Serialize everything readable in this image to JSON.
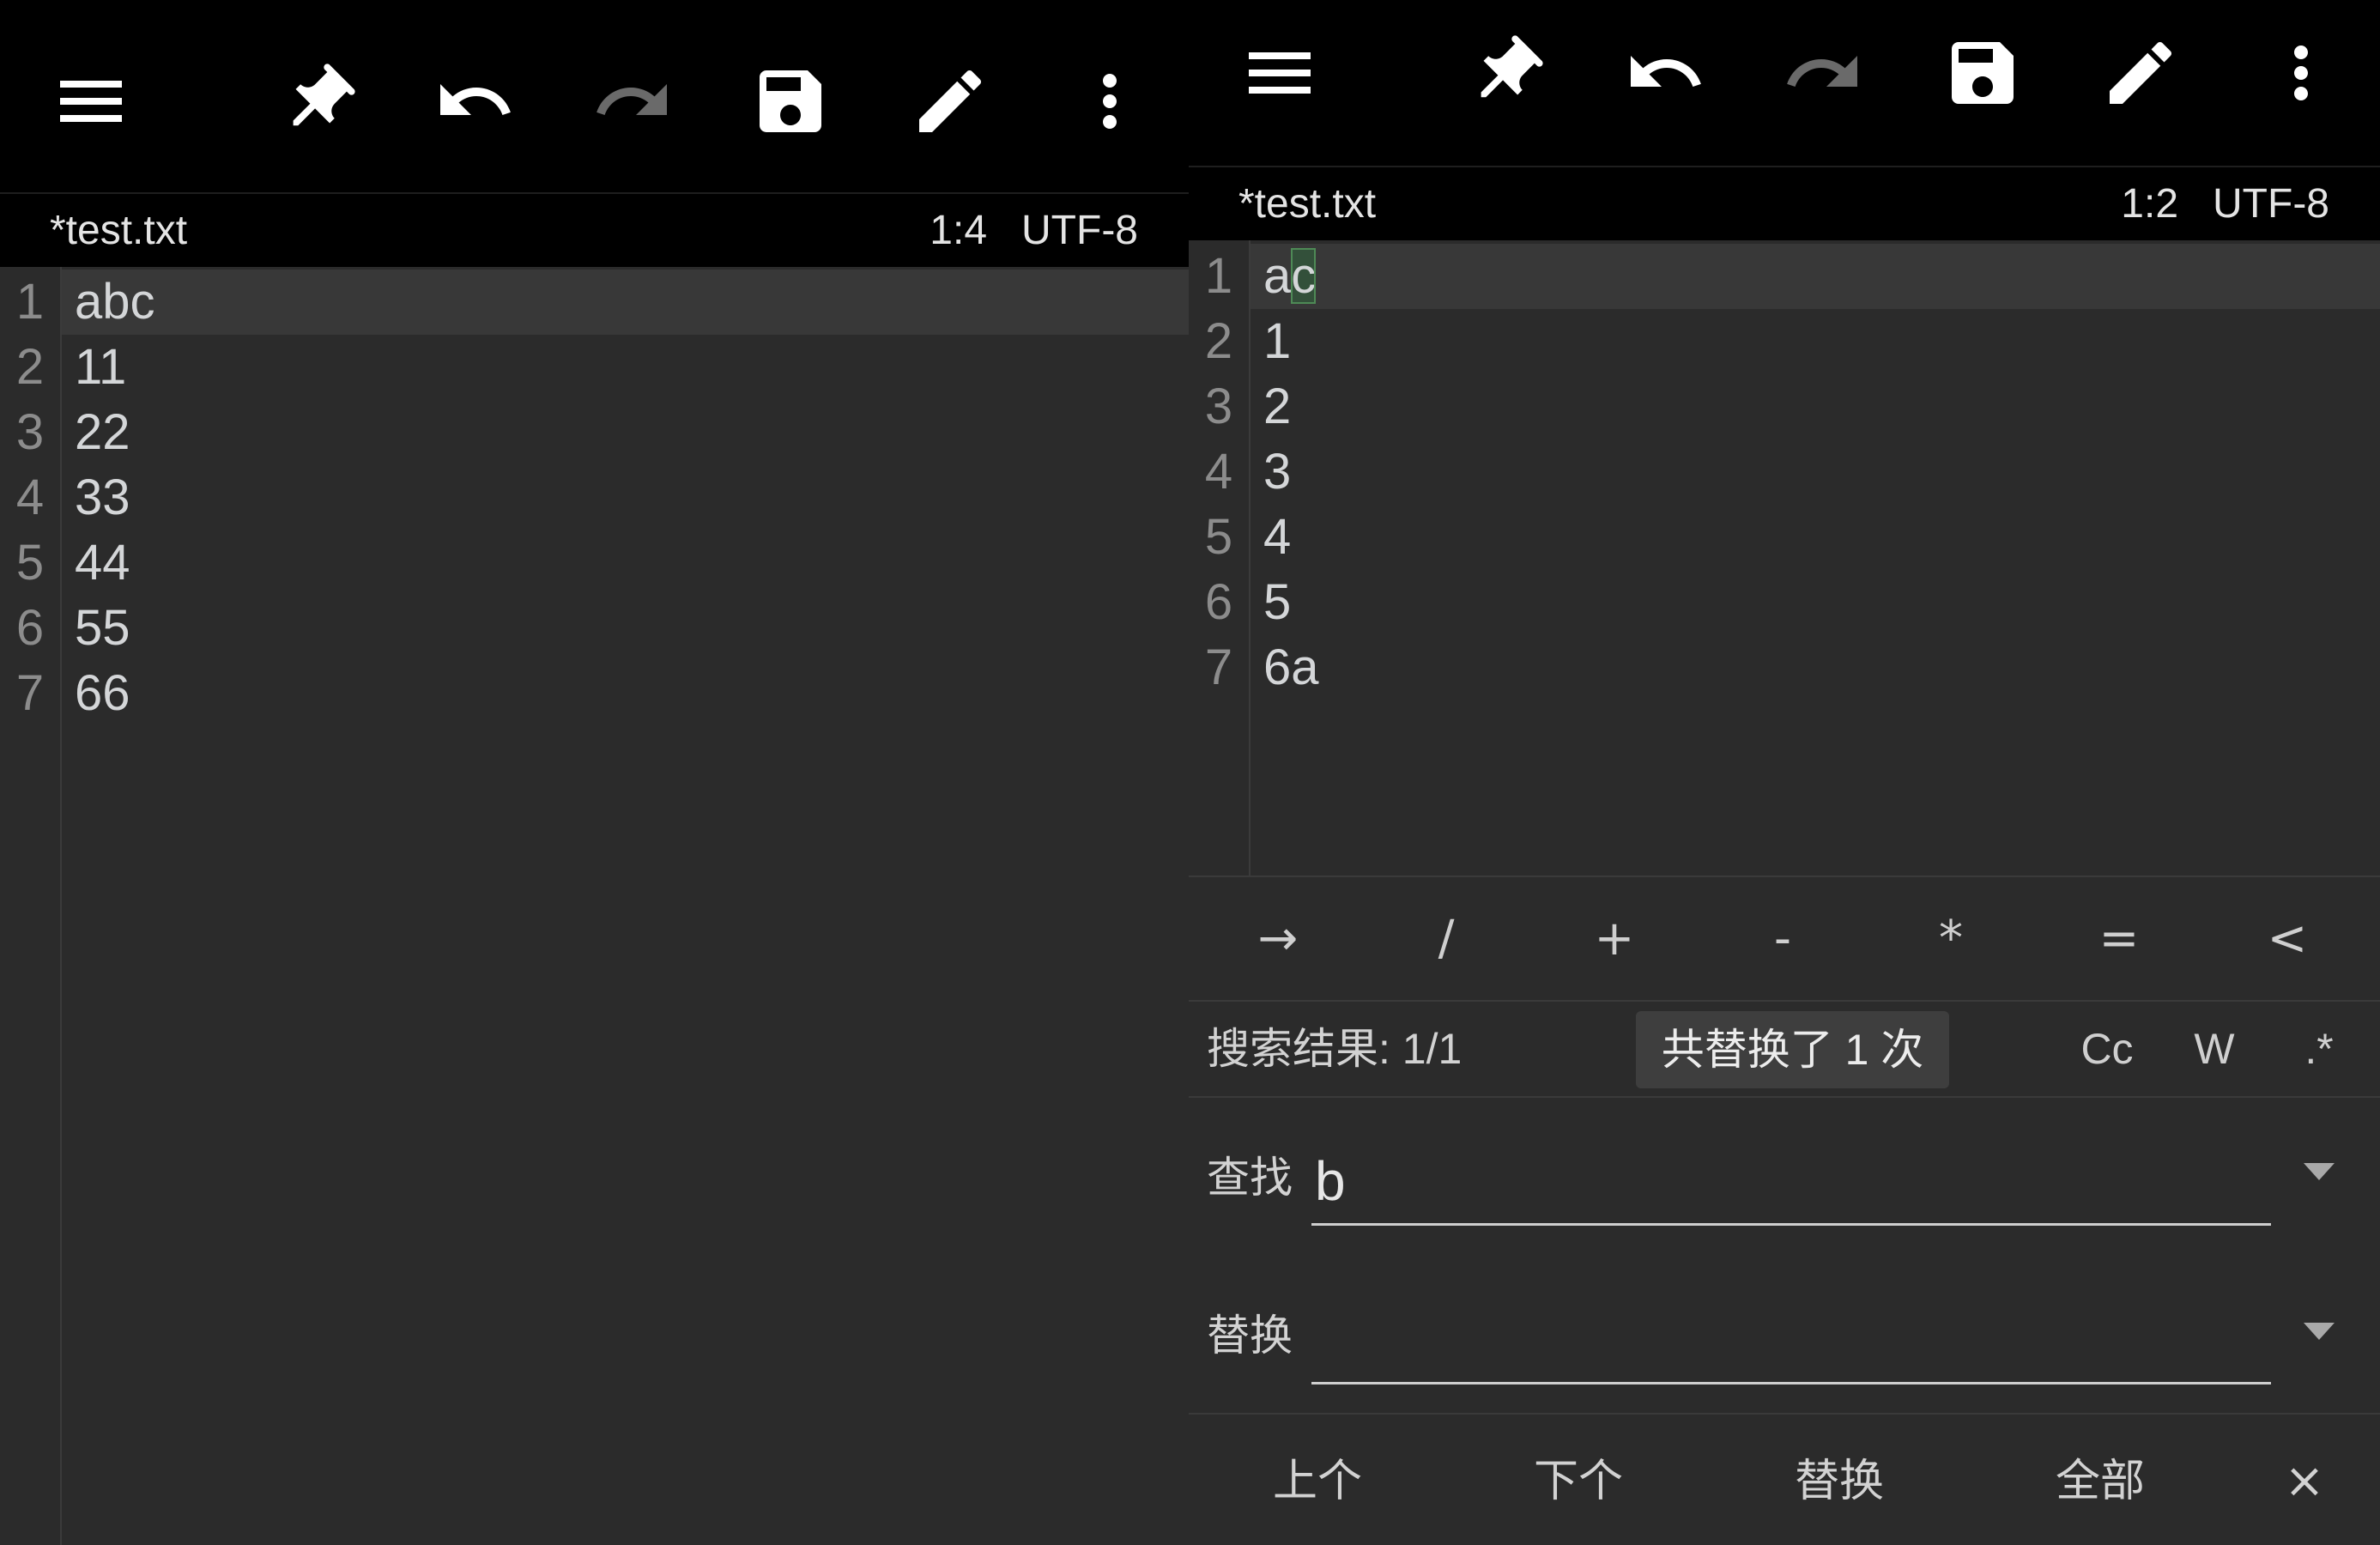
{
  "colors": {
    "toolbar_bg": "#000000",
    "editor_bg": "#2b2b2b",
    "current_line": "#383838",
    "text": "#d4d6d8",
    "line_number": "#8c8c8c",
    "icon": "#ffffff",
    "icon_disabled": "#6a6a6a",
    "match_bg": "#33503a",
    "match_border": "#4e8a56",
    "toast_bg": "#3e3e3e",
    "divider": "#3a3a3a"
  },
  "panels": [
    {
      "toolbar": {
        "icons": [
          "menu-icon",
          "pin-icon",
          "undo-icon",
          "redo-icon",
          "save-icon",
          "edit-icon",
          "more-vert-icon"
        ],
        "redo_enabled": false
      },
      "status": {
        "filename": "*test.txt",
        "cursor": "1:4",
        "encoding": "UTF-8"
      },
      "editor": {
        "current_line": 1,
        "lines": [
          {
            "num": "1",
            "text": "abc"
          },
          {
            "num": "2",
            "text": "11"
          },
          {
            "num": "3",
            "text": "22"
          },
          {
            "num": "4",
            "text": "33"
          },
          {
            "num": "5",
            "text": "44"
          },
          {
            "num": "6",
            "text": "55"
          },
          {
            "num": "7",
            "text": "66"
          }
        ]
      }
    },
    {
      "toolbar": {
        "icons": [
          "menu-icon",
          "pin-icon",
          "undo-icon",
          "redo-icon",
          "save-icon",
          "edit-icon",
          "more-vert-icon"
        ],
        "redo_enabled": false
      },
      "status": {
        "filename": "*test.txt",
        "cursor": "1:2",
        "encoding": "UTF-8"
      },
      "editor": {
        "current_line": 1,
        "lines": [
          {
            "num": "1",
            "text": "ac",
            "match": {
              "start": 1,
              "length": 1
            }
          },
          {
            "num": "2",
            "text": "1"
          },
          {
            "num": "3",
            "text": "2"
          },
          {
            "num": "4",
            "text": "3"
          },
          {
            "num": "5",
            "text": "4"
          },
          {
            "num": "6",
            "text": "5"
          },
          {
            "num": "7",
            "text": "6a"
          }
        ]
      },
      "symbol_bar": [
        "→",
        "/",
        "+",
        "-",
        "*",
        "=",
        "<"
      ],
      "search": {
        "results": "搜索结果: 1/1",
        "toast": "共替换了 1 次",
        "options": {
          "match_case": "Cc",
          "whole_word": "W",
          "regex": ".*"
        },
        "find": {
          "label": "查找",
          "value": "b"
        },
        "replace": {
          "label": "替换"
        },
        "actions": {
          "prev": "上个",
          "next": "下个",
          "replace": "替换",
          "replace_all": "全部",
          "close": "×"
        }
      }
    }
  ]
}
